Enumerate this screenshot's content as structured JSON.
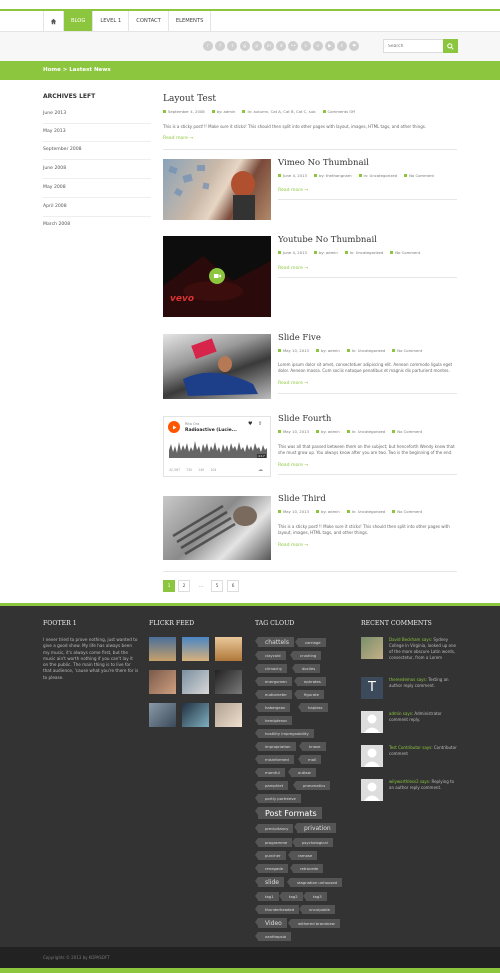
{
  "nav": {
    "home_icon": "home-icon",
    "items": [
      "BLOG",
      "LEVEL 1",
      "CONTACT",
      "ELEMENTS"
    ]
  },
  "socials": [
    "rss-icon",
    "facebook-icon",
    "twitter-icon",
    "google-plus-icon",
    "pinterest-icon",
    "linkedin-icon",
    "dribbble-icon",
    "flickr-icon",
    "skype-icon",
    "vimeo-icon",
    "youtube-icon",
    "tumblr-icon",
    "dribbble-icon"
  ],
  "search": {
    "placeholder": "Search"
  },
  "breadcrumb": "Home > Lastest News",
  "sidebar": {
    "title": "ARCHIVES LEFT",
    "items": [
      "June 2013",
      "May 2013",
      "September 2008",
      "June 2008",
      "May 2008",
      "April 2008",
      "March 2008"
    ]
  },
  "posts": [
    {
      "title": "Layout Test",
      "date": "September 4, 2008",
      "author": "by: admin",
      "cats": "In: autumn, Cat A, Cat B, Cat C, sub",
      "comments": "Comments Off",
      "excerpt": "This is a sticky post!!! Make sure it sticks! This should then split into other pages with layout, images, HTML tags, and other things.",
      "more": "Read more →"
    },
    {
      "title": "Vimeo No Thumbnail",
      "date": "June 4, 2013",
      "author": "by: thethangnam",
      "cats": "In: Uncategorized",
      "comments": "No Comment",
      "more": "Read more →"
    },
    {
      "title": "Youtube No Thumbnail",
      "date": "June 4, 2013",
      "author": "by: admin",
      "cats": "In: Uncategorized",
      "comments": "No Comment",
      "more": "Read more →",
      "video_label": "vevo"
    },
    {
      "title": "Slide Five",
      "date": "May 10, 2013",
      "author": "by: admin",
      "cats": "In: Uncategorized",
      "comments": "No Comment",
      "excerpt": "Lorem ipsum dolor sit amet, consectetuer adipiscing elit. Aenean commodo ligula eget dolor. Aenean massa. Cum sociis natoque penatibus et magnis dis parturient montes.",
      "more": "Read more →"
    },
    {
      "title": "Slide Fourth",
      "date": "May 10, 2013",
      "author": "by: admin",
      "cats": "In: Uncategorized",
      "comments": "No Comment",
      "excerpt": "This was all that passed between them on the subject; but henceforth Wendy knew that she must grow up. You always know after you are two. Two is the beginning of the end.",
      "more": "Read more →",
      "player": {
        "artist": "Rita Ora",
        "track": "Radioactive (Lucie...",
        "time": "4:17",
        "stats": [
          "42,567",
          "730",
          "140",
          "104"
        ]
      }
    },
    {
      "title": "Slide Third",
      "date": "May 10, 2013",
      "author": "by: admin",
      "cats": "In: Uncategorized",
      "comments": "No Comment",
      "excerpt": "This is a sticky post!!! Make sure it sticks! This should then split into other pages with layout, images, HTML tags, and other things.",
      "more": "Read more →"
    }
  ],
  "pagination": [
    "1",
    "2",
    "...",
    "5",
    "6"
  ],
  "footer": {
    "col1_title": "FOOTER 1",
    "col1_text": "I never tried to prove nothing, just wanted to give a good show. My life has always been my music, it's always come first, but the music ain't worth nothing if you can't lay it on the public. The main thing is to live for that audience, 'cause what you're there for is to please.",
    "flickr_title": "FLICKR FEED",
    "tags_title": "TAG CLOUD",
    "tags": [
      "chattels",
      "carriage",
      "claycold",
      "crushing",
      "climachy",
      "dociles",
      "energumen",
      "ephrates",
      "eudiometer",
      "figurate",
      "habergeon",
      "hapless",
      "hemipteron",
      "hostility impregnability",
      "impropriation",
      "knave",
      "misinformed",
      "moil",
      "mornful",
      "outlaw",
      "pamphlet",
      "pneumatics",
      "portly portreeve",
      "Post Formats",
      "precipitancy",
      "privation",
      "programme",
      "psychological",
      "puncher",
      "ramose",
      "renegade",
      "retrocede",
      "slide",
      "stagnation unhoused",
      "tag1",
      "tag2",
      "tag3",
      "thunderheaded",
      "unculpable",
      "Video",
      "withered brandnew",
      "xanthopsia"
    ],
    "comments_title": "RECENT COMMENTS",
    "comments": [
      {
        "who": "David Beckham says:",
        "text": "Sydney College in Virginia, looked up one of the more obscure Latin words, consectetur, from a Lorem"
      },
      {
        "who": "themedemos says:",
        "text": "Testing an author reply comment."
      },
      {
        "who": "admin says:",
        "text": "Administrator comment reply."
      },
      {
        "who": "Test Contributor says:",
        "text": "Contributor comment"
      },
      {
        "who": "wilyworthless2 says:",
        "text": "Replying to an author reply comment."
      }
    ]
  },
  "copyright": "Copyrights © 2013 by KOPASOFT",
  "colors": {
    "accent": "#8cc63f",
    "footer_bg": "#333333",
    "bottom_bg": "#222222"
  }
}
